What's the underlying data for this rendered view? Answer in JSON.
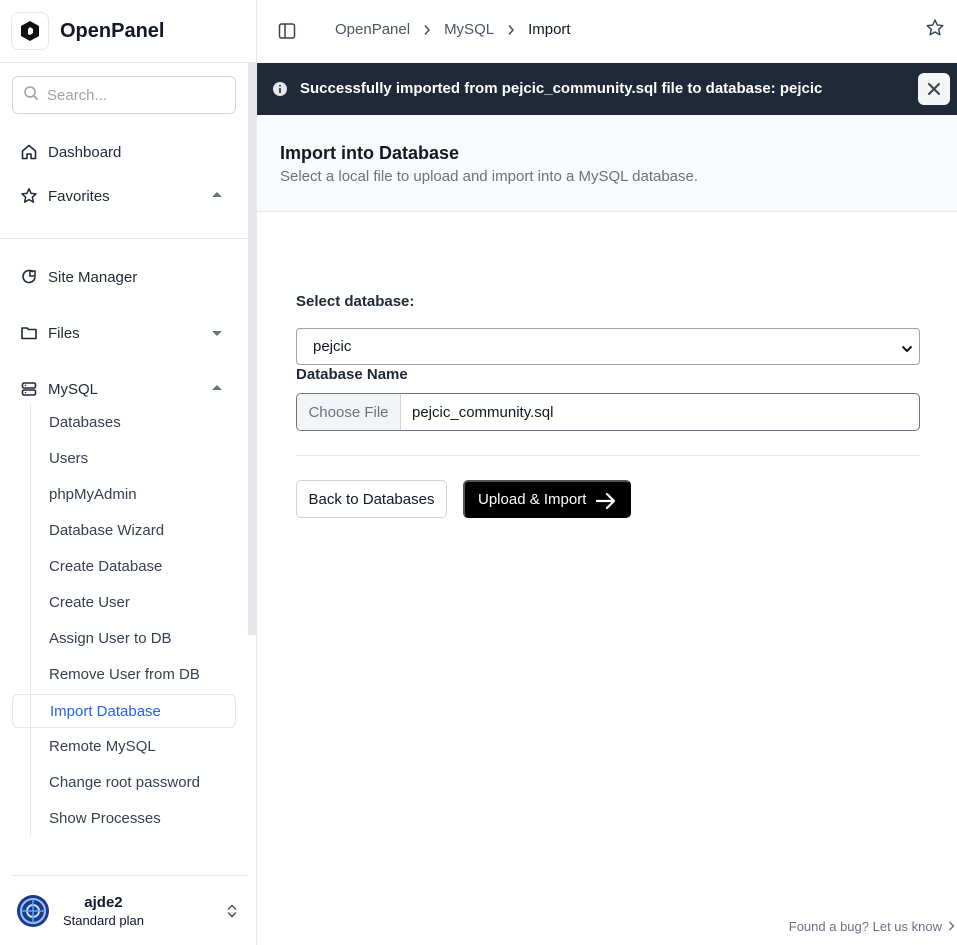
{
  "app": {
    "name": "OpenPanel"
  },
  "search": {
    "placeholder": "Search..."
  },
  "nav": {
    "dashboard": "Dashboard",
    "favorites": "Favorites",
    "site_manager": "Site Manager",
    "files": "Files",
    "mysql": "MySQL"
  },
  "mysql_items": [
    "Databases",
    "Users",
    "phpMyAdmin",
    "Database Wizard",
    "Create Database",
    "Create User",
    "Assign User to DB",
    "Remove User from DB",
    "Import Database",
    "Remote MySQL",
    "Change root password",
    "Show Processes"
  ],
  "user": {
    "name": "ajde2",
    "plan": "Standard plan"
  },
  "breadcrumb": [
    "OpenPanel",
    "MySQL",
    "Import"
  ],
  "alert": {
    "message": "Successfully imported from pejcic_community.sql file to database: pejcic"
  },
  "page": {
    "title": "Import into Database",
    "subtitle": "Select a local file to upload and import into a MySQL database."
  },
  "form": {
    "select_label": "Select database:",
    "selected_db": "pejcic",
    "file_label": "Database Name",
    "choose_file": "Choose File",
    "file_name": "pejcic_community.sql"
  },
  "buttons": {
    "back": "Back to Databases",
    "upload": "Upload & Import"
  },
  "footer": {
    "bug": "Found a bug? Let us know"
  },
  "colors": {
    "accent": "#2563eb",
    "alert_bg": "#1f2937",
    "primary_button": "#000000"
  }
}
